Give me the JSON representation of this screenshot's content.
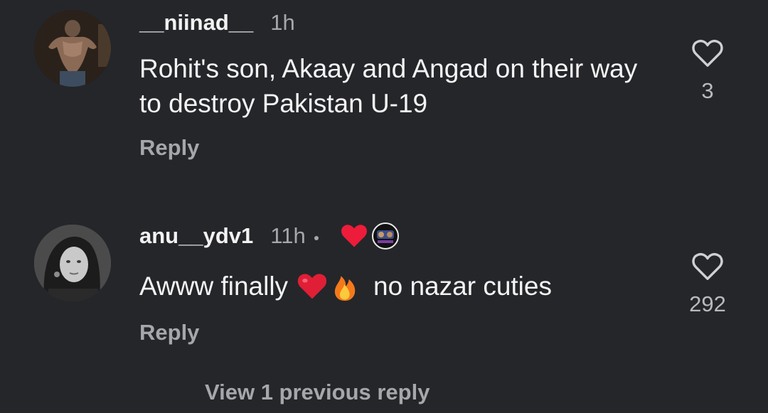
{
  "comments": [
    {
      "username": "__niinad__",
      "time": "1h",
      "text": "Rohit's son, Akaay and Angad on their way to destroy Pakistan U-19",
      "reply_label": "Reply",
      "like_count": "3",
      "avatar_icon": "person-photo-avatar",
      "like_icon": "heart-outline-icon"
    },
    {
      "username": "anu__ydv1",
      "time": "11h",
      "text_before": "Awww finally",
      "text_after": "no nazar cuties",
      "emojis": [
        "red-heart-emoji",
        "fire-emoji"
      ],
      "reactions": [
        "red-heart-icon",
        "creator-avatar-badge"
      ],
      "reply_label": "Reply",
      "like_count": "292",
      "avatar_icon": "person-photo-avatar",
      "like_icon": "heart-outline-icon"
    }
  ],
  "view_previous_label": "View 1 previous reply",
  "colors": {
    "background": "#25262a",
    "text_primary": "#f4f4f4",
    "text_secondary": "#a6a7ab",
    "heart_red": "#ed1c3a"
  }
}
